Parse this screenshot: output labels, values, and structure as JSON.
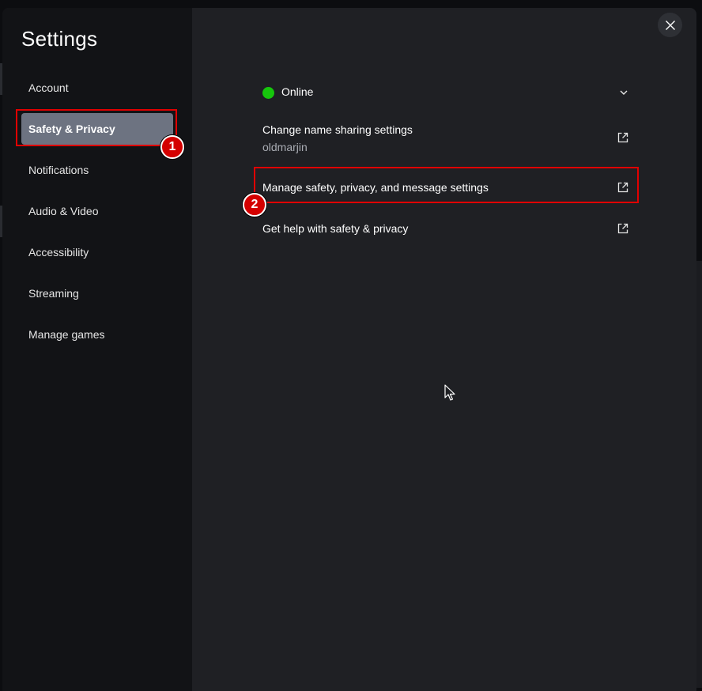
{
  "settings": {
    "title": "Settings",
    "nav": [
      {
        "label": "Account"
      },
      {
        "label": "Safety & Privacy",
        "selected": true
      },
      {
        "label": "Notifications"
      },
      {
        "label": "Audio & Video"
      },
      {
        "label": "Accessibility"
      },
      {
        "label": "Streaming"
      },
      {
        "label": "Manage games"
      }
    ]
  },
  "main": {
    "status": {
      "label": "Online",
      "color": "#16c60c",
      "icon": "chevron-down-icon"
    },
    "name_sharing": {
      "label": "Change name sharing settings",
      "value": "oldmarjin",
      "icon": "external-link-icon"
    },
    "manage": {
      "label": "Manage safety, privacy, and message settings",
      "icon": "external-link-icon"
    },
    "help": {
      "label": "Get help with safety & privacy",
      "icon": "external-link-icon"
    }
  },
  "callouts": [
    {
      "number": "1"
    },
    {
      "number": "2"
    }
  ],
  "colors": {
    "accent_red": "#e00000",
    "selected_bg": "#6d7381"
  }
}
